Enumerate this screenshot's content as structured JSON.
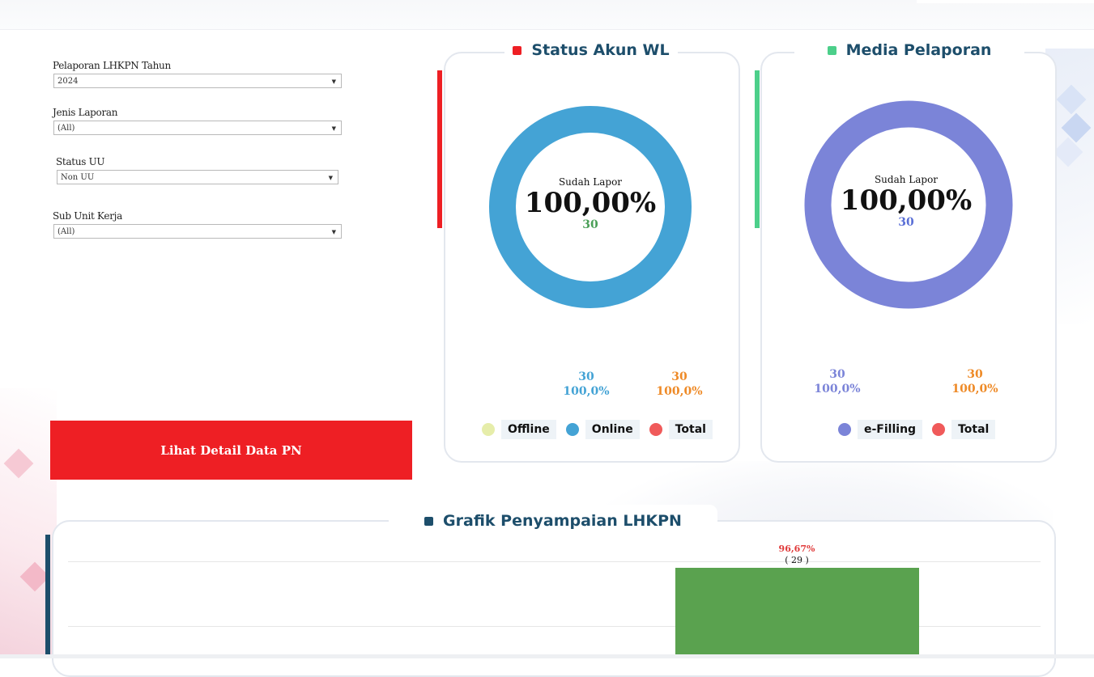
{
  "filters": {
    "tahun": {
      "label": "Pelaporan LHKPN Tahun",
      "value": "2024"
    },
    "jenis": {
      "label": "Jenis Laporan",
      "value": "(All)"
    },
    "status_uu": {
      "label": "Status UU",
      "value": "Non UU"
    },
    "sub_unit": {
      "label": "Sub Unit Kerja",
      "value": "(All)"
    }
  },
  "detail_button": "Lihat Detail Data PN",
  "status_akun": {
    "title": "Status Akun WL",
    "accent": "#ee1f24",
    "center_label": "Sudah Lapor",
    "center_pct": "100,00%",
    "center_count": "30",
    "ring_color": "#44a3d5",
    "stats": [
      {
        "count": "30",
        "pct": "100,0%",
        "color": "#44a3d5"
      },
      {
        "count": "30",
        "pct": "100,0%",
        "color": "#ee8a27"
      }
    ],
    "legend": [
      {
        "label": "Offline",
        "color": "#e6edaa"
      },
      {
        "label": "Online",
        "color": "#44a3d5"
      },
      {
        "label": "Total",
        "color": "#f05a5a"
      }
    ]
  },
  "media": {
    "title": "Media Pelaporan",
    "accent": "#4ccf8a",
    "center_label": "Sudah Lapor",
    "center_pct": "100,00%",
    "center_count": "30",
    "ring_color": "#7b84d8",
    "stats": [
      {
        "count": "30",
        "pct": "100,0%",
        "color": "#7b84d8"
      },
      {
        "count": "30",
        "pct": "100,0%",
        "color": "#ee8a27"
      }
    ],
    "legend": [
      {
        "label": "e-Filling",
        "color": "#7b84d8"
      },
      {
        "label": "Total",
        "color": "#f05a5a"
      }
    ]
  },
  "grafik": {
    "title": "Grafik Penyampaian LHKPN",
    "accent": "#1d4e6b"
  },
  "chart_data": {
    "type": "bar",
    "title": "Grafik Penyampaian LHKPN",
    "categories": [
      ""
    ],
    "series": [
      {
        "values": [
          96.67
        ],
        "counts": [
          29
        ],
        "color": "#5aa24f"
      }
    ],
    "data_labels": [
      "96,67%",
      "( 29 )"
    ]
  }
}
